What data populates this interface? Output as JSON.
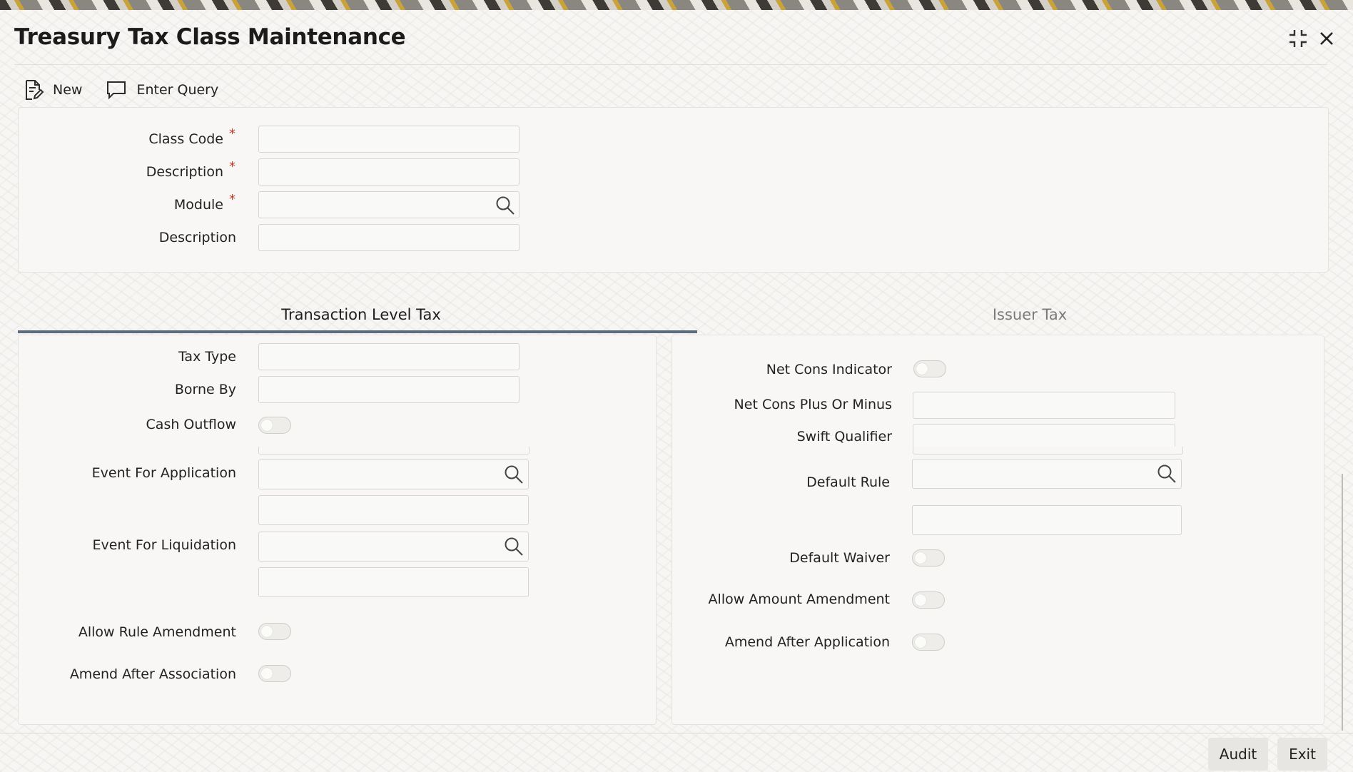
{
  "window": {
    "title": "Treasury Tax Class Maintenance",
    "controls": {
      "minimize_icon": "collapse-icon",
      "close_icon": "close-icon"
    }
  },
  "toolbar": {
    "new_label": "New",
    "enter_query_label": "Enter Query"
  },
  "header_form": {
    "class_code_label": "Class Code",
    "description_label": "Description",
    "module_label": "Module",
    "module_description_label": "Description",
    "required_mark": "*",
    "class_code_value": "",
    "description_value": "",
    "module_value": "",
    "module_description_value": ""
  },
  "tabs": [
    {
      "label": "Transaction Level Tax",
      "active": true
    },
    {
      "label": "Issuer Tax",
      "active": false
    }
  ],
  "transaction_tax": {
    "tax_type_label": "Tax Type",
    "borne_by_label": "Borne By",
    "cash_outflow_label": "Cash Outflow",
    "event_application_label": "Event For Application",
    "event_liquidation_label": "Event For Liquidation",
    "allow_rule_amendment_label": "Allow Rule Amendment",
    "amend_after_association_label": "Amend After Association",
    "cash_outflow_on": false,
    "allow_rule_amendment_on": false,
    "amend_after_association_on": false
  },
  "issuer_tax": {
    "net_cons_indicator_label": "Net Cons Indicator",
    "net_cons_plus_minus_label": "Net Cons Plus Or Minus",
    "swift_qualifier_label": "Swift Qualifier",
    "default_rule_label": "Default Rule",
    "default_waiver_label": "Default Waiver",
    "allow_amount_amendment_label": "Allow Amount Amendment",
    "amend_after_application_label": "Amend After Application",
    "net_cons_indicator_on": false,
    "default_waiver_on": false,
    "allow_amount_amendment_on": false,
    "amend_after_application_on": false
  },
  "footer": {
    "audit_label": "Audit",
    "exit_label": "Exit"
  },
  "colors": {
    "active_tab_underline": "#5d6b7e",
    "required_asterisk": "#c0392b"
  }
}
